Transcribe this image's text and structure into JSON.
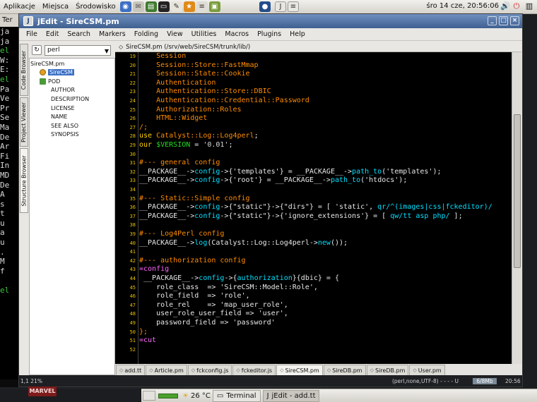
{
  "top_panel": {
    "menus": [
      "Aplikacje",
      "Miejsca",
      "Środowisko"
    ],
    "clock": "śro 14 cze, 20:56:06"
  },
  "background_terminal": {
    "tab_label": "Ter",
    "lines": [
      "ja",
      "ja",
      "el",
      "W:",
      "E:",
      "el",
      "Pa",
      "Ve",
      "Pr",
      "Se",
      "Ma",
      "De",
      "Ar",
      "Fi",
      "In",
      "MD",
      "De",
      " A",
      " s",
      " t",
      " u",
      " a",
      " u",
      " .",
      " M",
      " f",
      "",
      "el"
    ]
  },
  "window": {
    "title": "jEdit - SireCSM.pm",
    "menu": [
      "File",
      "Edit",
      "Search",
      "Markers",
      "Folding",
      "View",
      "Utilities",
      "Macros",
      "Plugins",
      "Help"
    ]
  },
  "side_tabs": [
    "Code Browser",
    "Project Viewer",
    "Structure Browser"
  ],
  "structure": {
    "mode": "perl",
    "tree": [
      {
        "label": "SireCSM.pm",
        "indent": 0,
        "icon": ""
      },
      {
        "label": "SireCSM",
        "indent": 1,
        "icon": "package"
      },
      {
        "label": "POD",
        "indent": 1,
        "icon": "pod"
      },
      {
        "label": "AUTHOR",
        "indent": 2,
        "icon": ""
      },
      {
        "label": "DESCRIPTION",
        "indent": 2,
        "icon": ""
      },
      {
        "label": "LICENSE",
        "indent": 2,
        "icon": ""
      },
      {
        "label": "NAME",
        "indent": 2,
        "icon": ""
      },
      {
        "label": "SEE ALSO",
        "indent": 2,
        "icon": ""
      },
      {
        "label": "SYNOPSIS",
        "indent": 2,
        "icon": ""
      }
    ]
  },
  "editor": {
    "buffer_path": "SireCSM.pm (/srv/web/SireCSM/trunk/lib/)",
    "colors": {
      "default": "#e8e8e8",
      "keyword": "#ffd000",
      "comment": "#ff8c00",
      "builtin": "#00e0ff",
      "string": "#d8d8d8",
      "var": "#22dd22",
      "pod": "#ff66ff"
    },
    "lines": [
      {
        "n": "19",
        "t": [
          [
            "c",
            "    Session"
          ]
        ]
      },
      {
        "n": "20",
        "t": [
          [
            "c",
            "    Session::Store::FastMmap"
          ]
        ]
      },
      {
        "n": "21",
        "t": [
          [
            "c",
            "    Session::State::Cookie"
          ]
        ]
      },
      {
        "n": "22",
        "t": [
          [
            "c",
            "    Authentication"
          ]
        ]
      },
      {
        "n": "23",
        "t": [
          [
            "c",
            "    Authentication::Store::DBIC"
          ]
        ]
      },
      {
        "n": "24",
        "t": [
          [
            "c",
            "    Authentication::Credential::Password"
          ]
        ]
      },
      {
        "n": "25",
        "t": [
          [
            "c",
            "    Authorization::Roles"
          ]
        ]
      },
      {
        "n": "26",
        "t": [
          [
            "c",
            "    HTML::Widget"
          ]
        ]
      },
      {
        "n": "27",
        "t": [
          [
            "c",
            "/;"
          ]
        ]
      },
      {
        "n": "28",
        "t": [
          [
            "k",
            "use"
          ],
          [
            "d",
            " "
          ],
          [
            "c",
            "Catalyst::Log::Log4perl"
          ],
          [
            "d",
            ";"
          ]
        ]
      },
      {
        "n": "29",
        "t": [
          [
            "k",
            "our"
          ],
          [
            "d",
            " "
          ],
          [
            "v",
            "$VERSION"
          ],
          [
            "d",
            " = "
          ],
          [
            "s",
            "'0.01'"
          ],
          [
            "d",
            ";"
          ]
        ]
      },
      {
        "n": "30",
        "t": [
          [
            "d",
            ""
          ]
        ]
      },
      {
        "n": "31",
        "t": [
          [
            "c",
            "#--- general config"
          ]
        ]
      },
      {
        "n": "32",
        "t": [
          [
            "d",
            "__PACKAGE__->"
          ],
          [
            "b",
            "config"
          ],
          [
            "d",
            "->{'templates'} = __PACKAGE__->"
          ],
          [
            "b",
            "path_to"
          ],
          [
            "d",
            "('templates');"
          ]
        ]
      },
      {
        "n": "33",
        "t": [
          [
            "d",
            "__PACKAGE__->"
          ],
          [
            "b",
            "config"
          ],
          [
            "d",
            "->{'root'} = __PACKAGE__->"
          ],
          [
            "b",
            "path_to"
          ],
          [
            "d",
            "('htdocs');"
          ]
        ]
      },
      {
        "n": "34",
        "t": [
          [
            "d",
            ""
          ]
        ]
      },
      {
        "n": "35",
        "t": [
          [
            "c",
            "#--- Static::Simple config"
          ]
        ]
      },
      {
        "n": "36",
        "t": [
          [
            "d",
            "__PACKAGE__->"
          ],
          [
            "b",
            "config"
          ],
          [
            "d",
            "->{\"static\"}->{\"dirs\"} = [ 'static', "
          ],
          [
            "b",
            "qr/^(images|css|fckeditor)/"
          ]
        ]
      },
      {
        "n": "37",
        "t": [
          [
            "d",
            "__PACKAGE__->"
          ],
          [
            "b",
            "config"
          ],
          [
            "d",
            "->{\"static\"}->{'ignore_extensions'} = [ "
          ],
          [
            "b",
            "qw/tt asp php/"
          ],
          [
            "d",
            " ];"
          ]
        ]
      },
      {
        "n": "38",
        "t": [
          [
            "d",
            ""
          ]
        ]
      },
      {
        "n": "39",
        "t": [
          [
            "c",
            "#--- Log4Perl config"
          ]
        ]
      },
      {
        "n": "40",
        "t": [
          [
            "d",
            "__PACKAGE__->"
          ],
          [
            "b",
            "log"
          ],
          [
            "d",
            "(Catalyst::Log::Log4perl->"
          ],
          [
            "b",
            "new"
          ],
          [
            "d",
            "());"
          ]
        ]
      },
      {
        "n": "41",
        "t": [
          [
            "d",
            ""
          ]
        ]
      },
      {
        "n": "42",
        "t": [
          [
            "c",
            "#--- authorization config"
          ]
        ]
      },
      {
        "n": "43",
        "t": [
          [
            "p",
            "=config"
          ]
        ]
      },
      {
        "n": "44",
        "t": [
          [
            "d",
            " __PACKAGE__->"
          ],
          [
            "b",
            "config"
          ],
          [
            "d",
            "->{"
          ],
          [
            "b",
            "authorization"
          ],
          [
            "d",
            "}{dbic} = {"
          ]
        ]
      },
      {
        "n": "45",
        "t": [
          [
            "d",
            "    role_class  => 'SireCSM::Model::Role',"
          ]
        ]
      },
      {
        "n": "46",
        "t": [
          [
            "d",
            "    role_field  => 'role',"
          ]
        ]
      },
      {
        "n": "47",
        "t": [
          [
            "d",
            "    role_rel    => 'map_user_role',"
          ]
        ]
      },
      {
        "n": "48",
        "t": [
          [
            "d",
            "    user_role_user_field => 'user',"
          ]
        ]
      },
      {
        "n": "49",
        "t": [
          [
            "d",
            "    password_field => 'password'"
          ]
        ]
      },
      {
        "n": "50",
        "t": [
          [
            "c",
            "};"
          ]
        ]
      },
      {
        "n": "51",
        "t": [
          [
            "p",
            "=cut"
          ]
        ]
      },
      {
        "n": "52",
        "t": [
          [
            "d",
            ""
          ]
        ]
      }
    ],
    "buffer_tabs": [
      "add.tt",
      "Article.pm",
      "fckconfig.js",
      "fckeditor.js",
      "SireCSM.pm",
      "SireDB.pm",
      "SireDB.pm",
      "User.pm"
    ],
    "active_tab": 4
  },
  "status": {
    "left": "1,1 21%",
    "mode": "(perl,none,UTF-8) - - - - U",
    "memory": "6/8Mb",
    "clock": "20:56"
  },
  "bottom_panel": {
    "weather": "26 °C",
    "tasks": [
      "Terminal",
      "jEdit - add.tt"
    ]
  }
}
